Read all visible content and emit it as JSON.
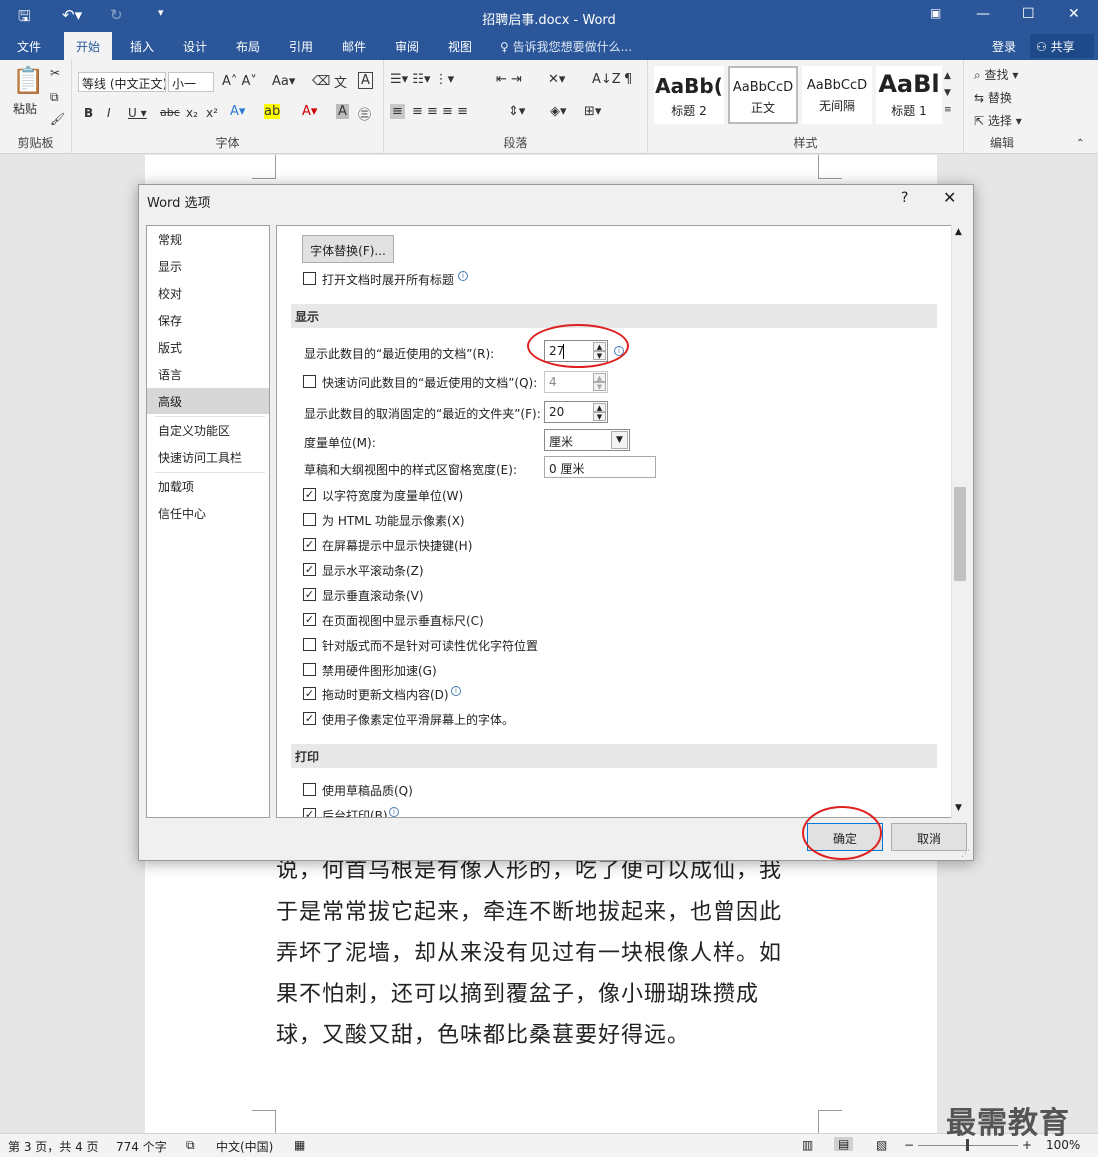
{
  "app": {
    "title": "招聘启事.docx - Word",
    "tabs": [
      "文件",
      "开始",
      "插入",
      "设计",
      "布局",
      "引用",
      "邮件",
      "审阅",
      "视图"
    ],
    "active_tab": "开始",
    "tell_me": "告诉我您想要做什么...",
    "login": "登录",
    "share": "共享"
  },
  "ribbon": {
    "clipboard": {
      "label": "剪贴板",
      "paste": "粘贴"
    },
    "font": {
      "label": "字体",
      "font_name": "等线 (中文正文)",
      "font_size": "小一"
    },
    "paragraph": {
      "label": "段落"
    },
    "styles": {
      "label": "样式",
      "items": [
        {
          "preview": "AaBb(",
          "name": "标题 2"
        },
        {
          "preview": "AaBbCcD",
          "name": "正文"
        },
        {
          "preview": "AaBbCcD",
          "name": "无间隔"
        },
        {
          "preview": "AaBl",
          "name": "标题 1"
        }
      ]
    },
    "editing": {
      "label": "编辑",
      "find": "查找",
      "replace": "替换",
      "select": "选择"
    }
  },
  "document": {
    "lines": [
      "说，何首乌根是有像人形的，吃了便可以成仙，我",
      "于是常常拔它起来，牵连不断地拔起来，也曾因此",
      "弄坏了泥墙，却从来没有见过有一块根像人样。如",
      "果不怕刺，还可以摘到覆盆子，像小珊瑚珠攒成",
      "球，又酸又甜，色味都比桑葚要好得远。"
    ]
  },
  "status": {
    "page": "第 3 页，共 4 页",
    "words": "774 个字",
    "language": "中文(中国)",
    "zoom": "100%"
  },
  "watermark": "最需教育",
  "dialog": {
    "title": "Word 选项",
    "help": "?",
    "nav": [
      "常规",
      "显示",
      "校对",
      "保存",
      "版式",
      "语言",
      "高级",
      "自定义功能区",
      "快速访问工具栏",
      "加载项",
      "信任中心"
    ],
    "selected_nav": "高级",
    "font_sub_button": "字体替换(F)...",
    "expand_headings": "打开文档时展开所有标题",
    "section_display": "显示",
    "recent_docs_label": "显示此数目的“最近使用的文档”(R):",
    "recent_docs_value": "27",
    "quick_access_label": "快速访问此数目的“最近使用的文档”(Q):",
    "quick_access_value": "4",
    "unpinned_folders_label": "显示此数目的取消固定的“最近的文件夹”(F):",
    "unpinned_folders_value": "20",
    "units_label": "度量单位(M):",
    "units_value": "厘米",
    "style_area_label": "草稿和大纲视图中的样式区窗格宽度(E):",
    "style_area_value": "0 厘米",
    "checkboxes": [
      {
        "label": "以字符宽度为度量单位(W)",
        "checked": true
      },
      {
        "label": "为 HTML 功能显示像素(X)",
        "checked": false
      },
      {
        "label": "在屏幕提示中显示快捷键(H)",
        "checked": true
      },
      {
        "label": "显示水平滚动条(Z)",
        "checked": true
      },
      {
        "label": "显示垂直滚动条(V)",
        "checked": true
      },
      {
        "label": "在页面视图中显示垂直标尺(C)",
        "checked": true
      },
      {
        "label": "针对版式而不是针对可读性优化字符位置",
        "checked": false
      },
      {
        "label": "禁用硬件图形加速(G)",
        "checked": false
      },
      {
        "label": "拖动时更新文档内容(D)",
        "checked": true
      },
      {
        "label": "使用子像素定位平滑屏幕上的字体。",
        "checked": true
      }
    ],
    "section_print": "打印",
    "print_checkboxes": [
      {
        "label": "使用草稿品质(Q)",
        "checked": false
      },
      {
        "label": "后台打印(B)",
        "checked": true
      }
    ],
    "ok": "确定",
    "cancel": "取消"
  },
  "colors": {
    "accent": "#2b579a",
    "highlight": "#e02020"
  }
}
